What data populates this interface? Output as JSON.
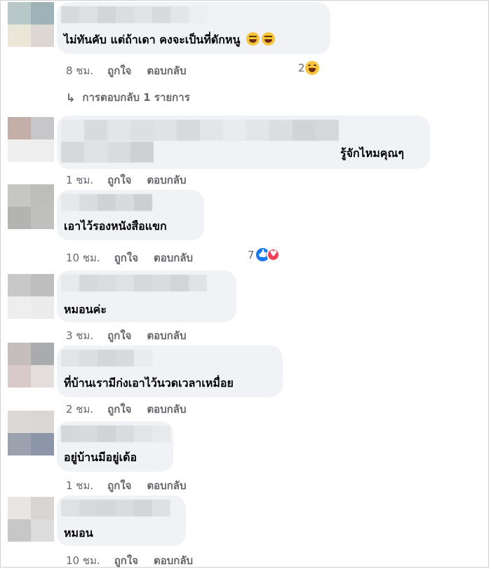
{
  "comments": [
    {
      "text": "ไม่ทันคับ แต่ถ้าเดา คงจะเป็นที่ดักหนู",
      "time": "8 ชม.",
      "like": "ถูกใจ",
      "reply": "ตอบกลับ",
      "reaction_count": "2",
      "reaction_icons": [
        "haha-emoji-icon"
      ],
      "replies_label": "การตอบกลับ 1 รายการ"
    },
    {
      "text": "รู้จักไหมคุณๆ",
      "time": "1 ชม.",
      "like": "ถูกใจ",
      "reply": "ตอบกลับ"
    },
    {
      "text": "เอาไว้รองหนังสือแขก",
      "time": "10 ชม.",
      "like": "ถูกใจ",
      "reply": "ตอบกลับ",
      "reaction_count": "7",
      "reaction_icons": [
        "like-reaction-icon",
        "love-reaction-icon"
      ]
    },
    {
      "text": "หมอนค่ะ",
      "time": "3 ชม.",
      "like": "ถูกใจ",
      "reply": "ตอบกลับ"
    },
    {
      "text": "ที่บ้านเรามีก่งเอาไว้นวดเวลาเหมื่อย",
      "time": "2 ชม.",
      "like": "ถูกใจ",
      "reply": "ตอบกลับ"
    },
    {
      "text": "อยู่บ้านมีอยู่เด้อ",
      "time": "1 ชม.",
      "like": "ถูกใจ",
      "reply": "ตอบกลับ"
    },
    {
      "text": "หมอน",
      "time": "10 ชม.",
      "like": "ถูกใจ",
      "reply": "ตอบกลับ"
    }
  ],
  "colors": {
    "bubble": "#f0f2f5",
    "meta_text": "#65676b",
    "like_blue": "#1877f2",
    "love_red": "#f33e58",
    "haha_yellow": "#f7c53b"
  }
}
